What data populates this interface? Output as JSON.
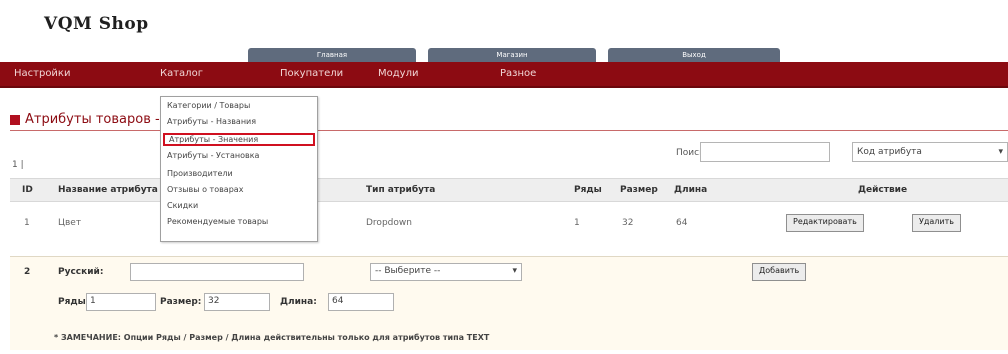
{
  "app": {
    "logo": "VQM Shop"
  },
  "top_tabs": [
    "Главная",
    "Магазин",
    "Выход"
  ],
  "nav": [
    "Настройки",
    "Каталог",
    "Покупатели",
    "Модули",
    "Разное",
    "Разное"
  ],
  "dropdown_items": [
    "Категории / Товары",
    "Атрибуты - Названия",
    "Атрибуты - Значения",
    "Атрибуты - Установка",
    "Производители",
    "Отзывы о товарах",
    "Скидки",
    "Рекомендуемые товары"
  ],
  "page": {
    "title": "Атрибуты товаров - Названия атрибутов",
    "pager": "1 |"
  },
  "search": {
    "label": "Поиск:",
    "value": "",
    "sort": "Код атрибута"
  },
  "table": {
    "headers": [
      "ID",
      "Название атрибута",
      "Тип атрибута",
      "Ряды",
      "Размер",
      "Длина",
      "Действие"
    ],
    "rows": [
      {
        "id": "1",
        "name": "Цвет",
        "type": "Dropdown",
        "rows": "1",
        "size": "32",
        "length": "64"
      }
    ],
    "edit_label": "Редактировать",
    "delete_label": "Удалить"
  },
  "form": {
    "num": "2",
    "lang_label": "Русский:",
    "lang_value": "",
    "type_placeholder": "-- Выберите --",
    "add_label": "Добавить",
    "rows_label": "Ряды:",
    "rows_value": "1",
    "size_label": "Размер:",
    "size_value": "32",
    "len_label": "Длина:",
    "len_value": "64",
    "note": "* ЗАМЕЧАНИЕ: Опции Ряды / Размер / Длина действительны только для атрибутов типа TEXT"
  },
  "colors": {
    "nav_bg": "#8c0b12",
    "tab_bg": "#5f6b7d",
    "highlight": "#d01020",
    "form_bg": "#fffaef"
  }
}
